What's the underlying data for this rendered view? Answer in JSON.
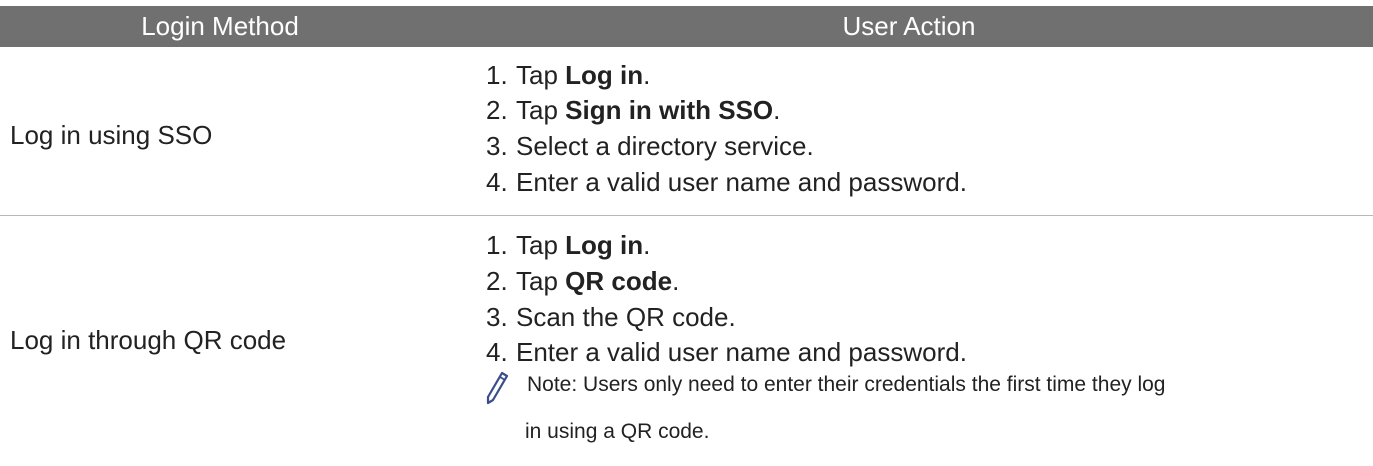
{
  "table": {
    "headers": {
      "method": "Login Method",
      "action": "User Action"
    },
    "rows": [
      {
        "method": "Log in using SSO",
        "steps": [
          {
            "num": "1.",
            "pre": "Tap ",
            "bold": "Log in",
            "post": "."
          },
          {
            "num": "2.",
            "pre": "Tap ",
            "bold": "Sign in with SSO",
            "post": "."
          },
          {
            "num": "3.",
            "pre": "Select a directory service.",
            "bold": "",
            "post": ""
          },
          {
            "num": "4.",
            "pre": "Enter a valid user name and password.",
            "bold": "",
            "post": ""
          }
        ]
      },
      {
        "method": "Log in through QR code",
        "steps": [
          {
            "num": "1.",
            "pre": "Tap ",
            "bold": "Log in",
            "post": "."
          },
          {
            "num": "2.",
            "pre": "Tap ",
            "bold": "QR code",
            "post": "."
          },
          {
            "num": "3.",
            "pre": "Scan the QR code.",
            "bold": "",
            "post": ""
          },
          {
            "num": "4.",
            "pre": "Enter a valid user name and password.",
            "bold": "",
            "post": ""
          }
        ],
        "note": {
          "icon": "pencil-icon",
          "line1": "Note: Users only need to enter their credentials the first time they log",
          "line2": "in using a QR code."
        }
      }
    ]
  },
  "colors": {
    "header_bg": "#707070",
    "header_text": "#ffffff",
    "divider": "#b8b8b8",
    "icon_stroke": "#3a4e8c"
  }
}
